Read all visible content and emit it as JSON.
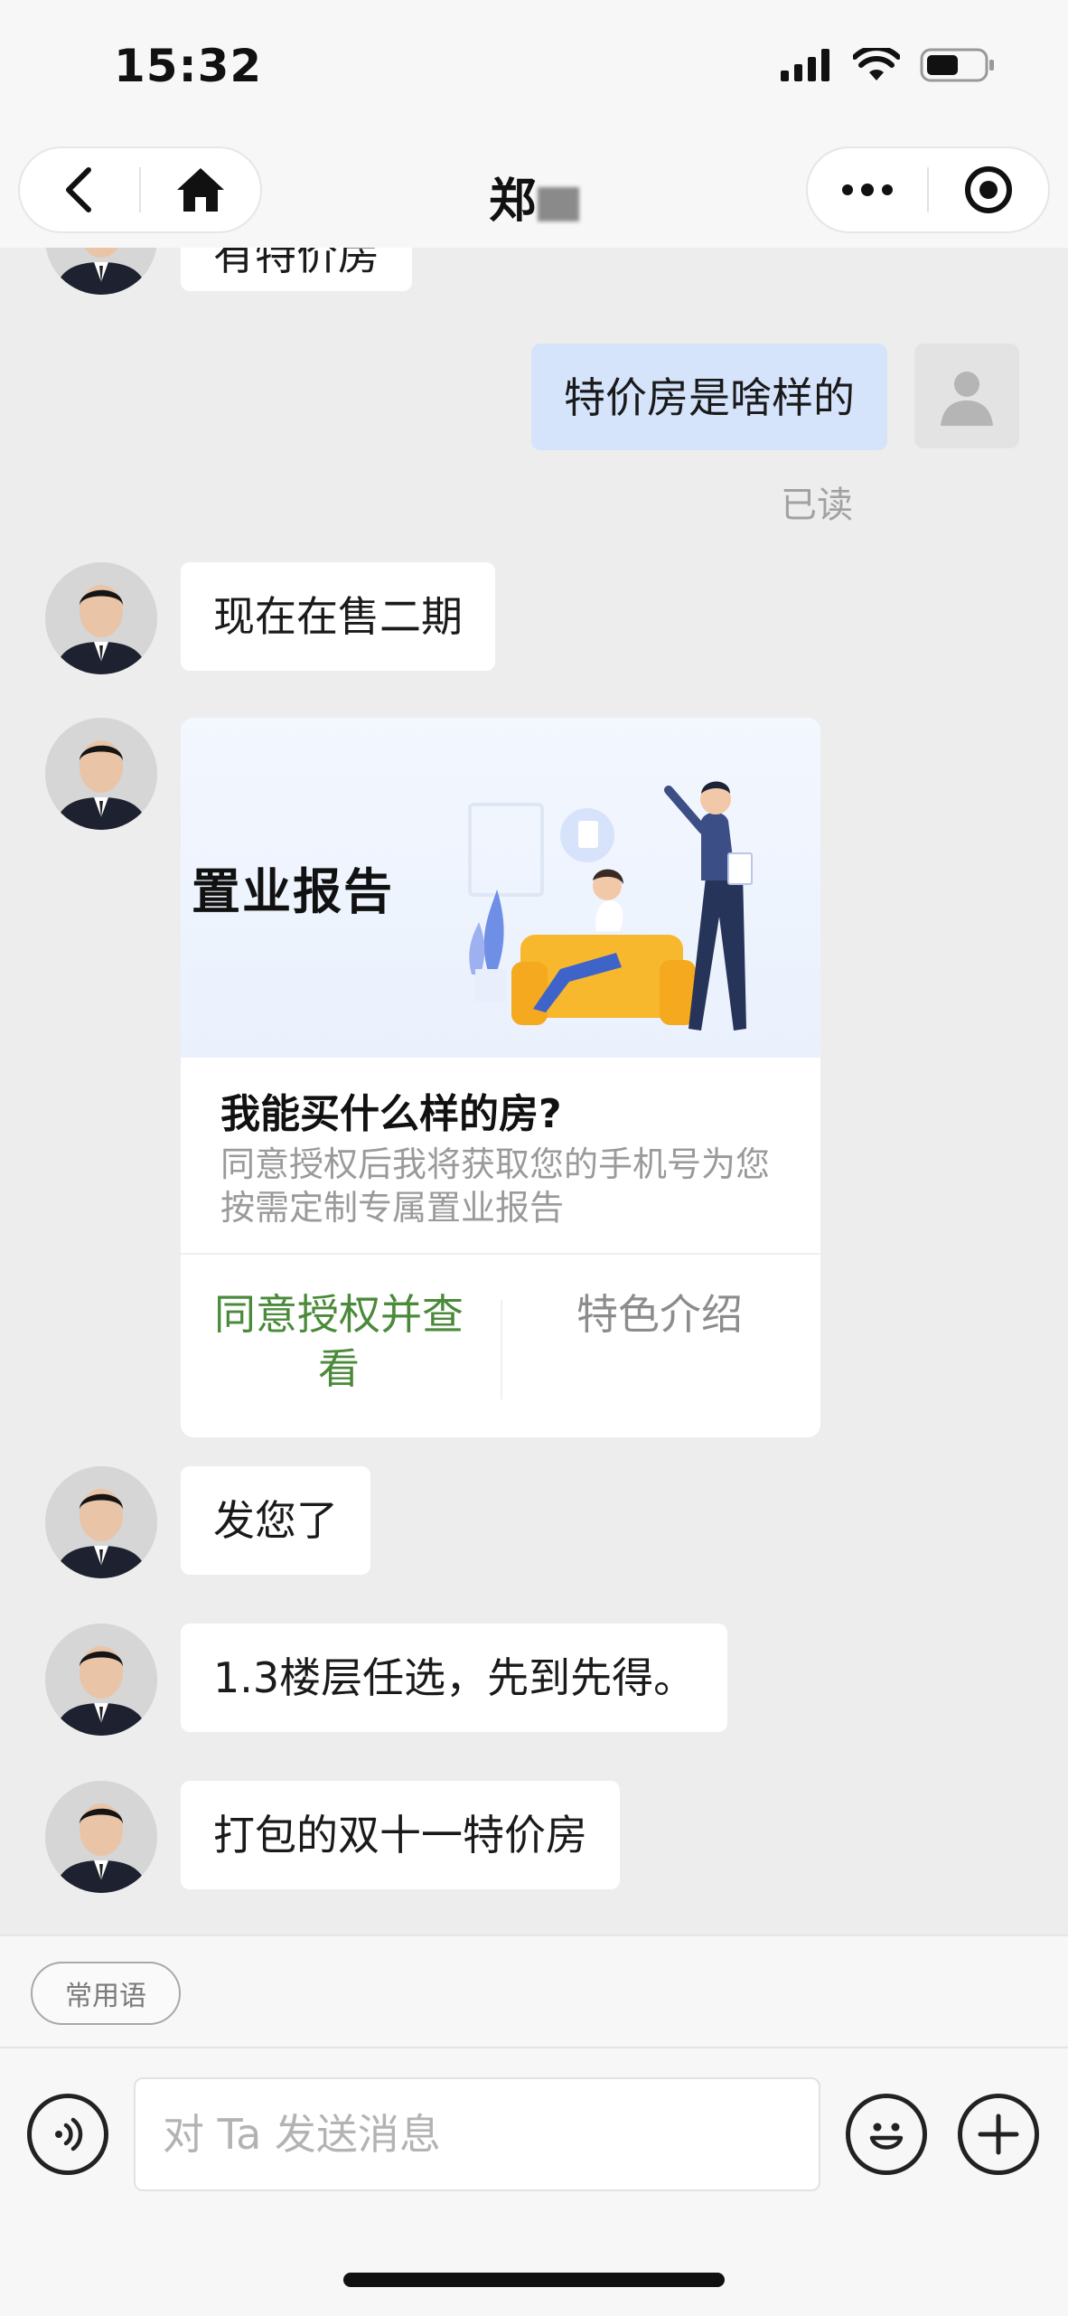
{
  "status_bar": {
    "time": "15:32",
    "icons": [
      "signal-icon",
      "wifi-icon",
      "battery-icon"
    ]
  },
  "nav": {
    "title": "郑",
    "icons": [
      "back-icon",
      "home-icon",
      "more-icon",
      "close-miniprogram-icon"
    ]
  },
  "messages": [
    {
      "from": "agent",
      "text": "有特价房",
      "partial": true
    },
    {
      "from": "self",
      "text": "特价房是啥样的",
      "status": "已读"
    },
    {
      "from": "agent",
      "text": "现在在售二期"
    },
    {
      "from": "agent",
      "type": "card",
      "card": {
        "banner_title": "置业报告",
        "question": "我能买什么样的房?",
        "description": "同意授权后我将获取您的手机号为您按需定制专属置业报告",
        "agree_button": "同意授权并查看",
        "feature_button": "特色介绍"
      }
    },
    {
      "from": "agent",
      "text": "发您了"
    },
    {
      "from": "agent",
      "text": "1.3楼层任选，先到先得。"
    },
    {
      "from": "agent",
      "text": "打包的双十一特价房"
    }
  ],
  "quick_phrases": {
    "label": "常用语"
  },
  "composer": {
    "placeholder": "对 Ta 发送消息",
    "value": "",
    "icons": [
      "voice-icon",
      "emoji-icon",
      "plus-icon"
    ]
  },
  "colors": {
    "self_bubble": "#d5e4fb",
    "agree_text": "#4a8a3a",
    "background": "#ededed"
  }
}
